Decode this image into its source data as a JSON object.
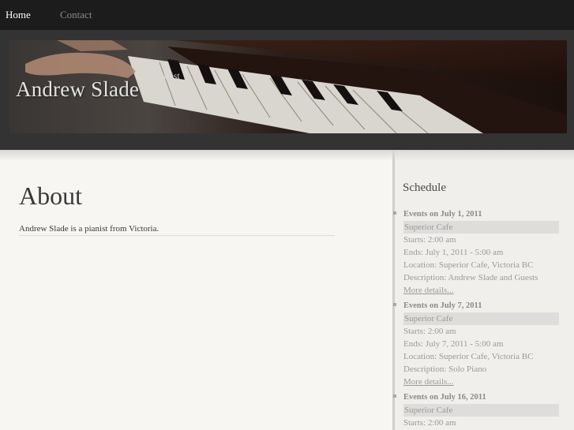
{
  "nav": {
    "home": "Home",
    "contact": "Contact"
  },
  "site": {
    "title": "Andrew Slade",
    "tagline": "Pianist"
  },
  "page": {
    "title": "About",
    "body": "Andrew Slade is a pianist from Victoria."
  },
  "schedule": {
    "title": "Schedule",
    "events": [
      {
        "heading": "Events on July 1, 2011",
        "venue": "Superior Cafe",
        "starts": "Starts: 2:00 am",
        "ends": "Ends: July 1, 2011 - 5:00 am",
        "location": "Location: Superior Cafe, Victoria BC",
        "description": "Description: Andrew Slade and Guests",
        "more": "More details..."
      },
      {
        "heading": "Events on July 7, 2011",
        "venue": "Superior Cafe",
        "starts": "Starts: 2:00 am",
        "ends": "Ends: July 7, 2011 - 5:00 am",
        "location": "Location: Superior Cafe, Victoria BC",
        "description": "Description: Solo Piano",
        "more": "More details..."
      },
      {
        "heading": "Events on July 16, 2011",
        "venue": "Superior Cafe",
        "starts": "Starts: 2:00 am"
      }
    ]
  }
}
